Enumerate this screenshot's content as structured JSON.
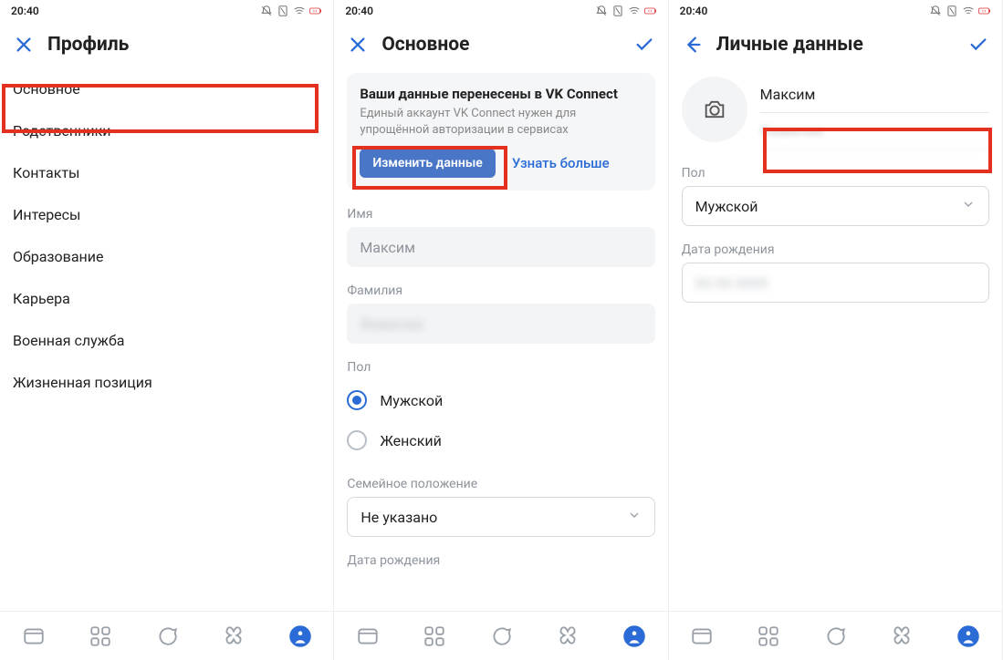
{
  "status": {
    "time": "20:40",
    "battery": "11"
  },
  "screen1": {
    "title": "Профиль",
    "items": [
      "Основное",
      "Родственники",
      "Контакты",
      "Интересы",
      "Образование",
      "Карьера",
      "Военная служба",
      "Жизненная позиция"
    ]
  },
  "screen2": {
    "title": "Основное",
    "card": {
      "title": "Ваши данные перенесены в VK Connect",
      "sub": "Единый аккаунт VK Connect нужен для упрощённой авторизации в сервисах",
      "primary": "Изменить данные",
      "secondary": "Узнать больше"
    },
    "labels": {
      "name": "Имя",
      "surname": "Фамилия",
      "gender": "Пол",
      "marital": "Семейное положение",
      "dob": "Дата рождения"
    },
    "values": {
      "name": "Максим",
      "surname_blur": "Фамилия",
      "marital": "Не указано"
    },
    "gender": {
      "male": "Мужской",
      "female": "Женский"
    }
  },
  "screen3": {
    "title": "Личные данные",
    "name": "Максим",
    "surname_blur": "Фамилия",
    "labels": {
      "gender": "Пол",
      "dob": "Дата рождения"
    },
    "gender_value": "Мужской",
    "dob_blur": "00.00.0000"
  },
  "colors": {
    "accent": "#2a6bd6",
    "primary_btn": "#4a76c8",
    "highlight": "#e4311f"
  }
}
